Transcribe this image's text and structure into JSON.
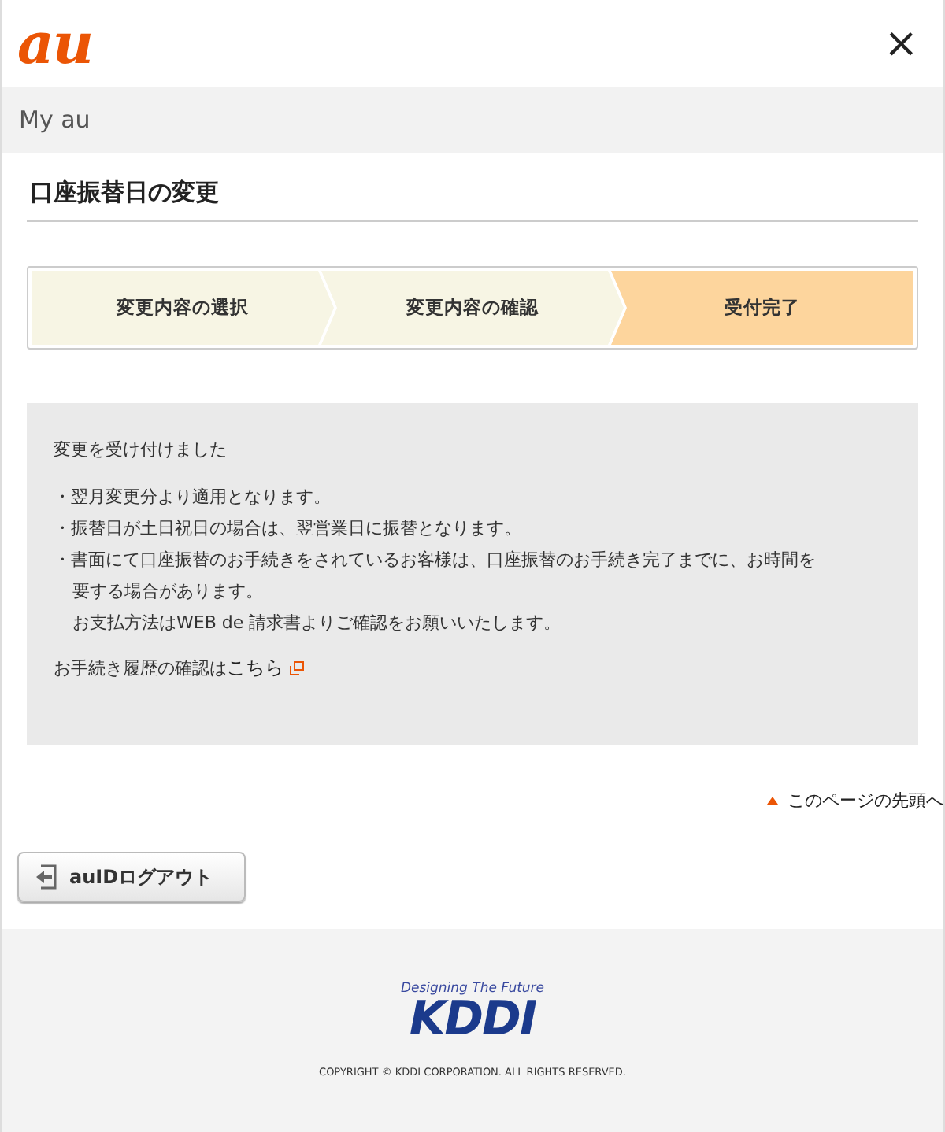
{
  "header": {
    "logo": "au",
    "close": "×"
  },
  "section_bar": {
    "title": "My au"
  },
  "page_title": "口座振替日の変更",
  "steps": [
    {
      "label": "変更内容の選択",
      "selected": false
    },
    {
      "label": "変更内容の確認",
      "selected": false
    },
    {
      "label": "受付完了",
      "selected": true
    }
  ],
  "message": {
    "heading": "変更を受け付けました",
    "bullets": [
      {
        "lines": [
          "・翌月変更分より適用となります。"
        ]
      },
      {
        "lines": [
          "・振替日が土日祝日の場合は、翌営業日に振替となります。"
        ]
      },
      {
        "lines": [
          "・書面にて口座振替のお手続きをされているお客様は、口座振替のお手続き完了までに、お時間を",
          "要する場合があります。",
          "お支払方法はWEB de 請求書よりご確認をお願いいたします。"
        ]
      }
    ],
    "history_text": "お手続き履歴の確認は",
    "history_link": "こちら"
  },
  "page_top_link": "このページの先頭へ",
  "logout_button": "auIDログアウト",
  "footer": {
    "tagline": "Designing The Future",
    "logo": "KDDI",
    "copyright": "COPYRIGHT © KDDI CORPORATION. ALL RIGHTS RESERVED."
  }
}
